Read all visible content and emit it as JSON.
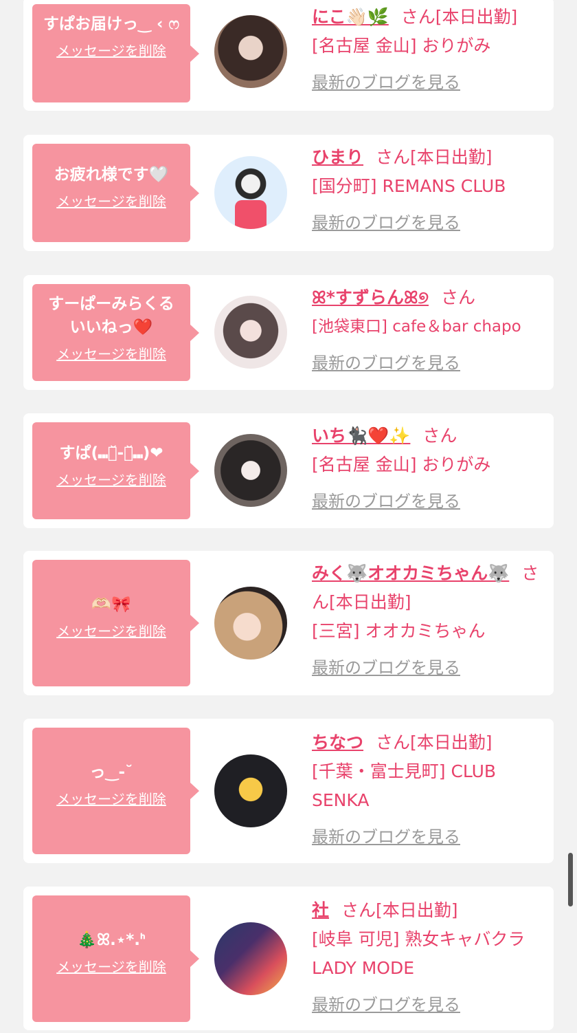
{
  "common": {
    "delete_label": "メッセージを削除",
    "blog_label": "最新のブログを見る"
  },
  "colors": {
    "background": "#f2f2f2",
    "bubble": "#f6949f",
    "accent": "#e8426b",
    "link_gray": "#9a9a9a"
  },
  "cards": [
    {
      "message": "すぱお届けっ‿ ‹ ෆ",
      "name": "にこ👋🏻🌿",
      "suffix": "さん[本日出勤]",
      "shop": "[名古屋 金山] おりがみ"
    },
    {
      "message": "お疲れ様です🤍",
      "name": "ひまり",
      "suffix": "さん[本日出勤]",
      "shop": "[国分町] REMANS CLUB"
    },
    {
      "message": "すーぱーみらくる いいねっ❤️",
      "name": "ꕤ*すずらんꕤ୭",
      "suffix": "さん",
      "shop": "[池袋東口] cafe＆bar chapo"
    },
    {
      "message": "すぱ(⑉・̆-・̆⑉)❤",
      "name": "いち🐈‍⬛❤️✨",
      "suffix": "さん",
      "shop": "[名古屋 金山] おりがみ"
    },
    {
      "message": "🫶🏻🎀",
      "name": "みく🐺オオカミちゃん🐺",
      "suffix": "さん[本日出勤]",
      "shop": "[三宮] オオカミちゃん"
    },
    {
      "message": "っ‿-˘",
      "name": "ちなつ",
      "suffix": "さん[本日出勤]",
      "shop": "[千葉・富士見町] CLUB SENKA"
    },
    {
      "message": "🎄ꕤ.⋆*.ᑋ",
      "name": "社",
      "suffix": "さん[本日出勤]",
      "shop": "[岐阜 可児] 熟女キャバクラ LADY MODE"
    }
  ]
}
